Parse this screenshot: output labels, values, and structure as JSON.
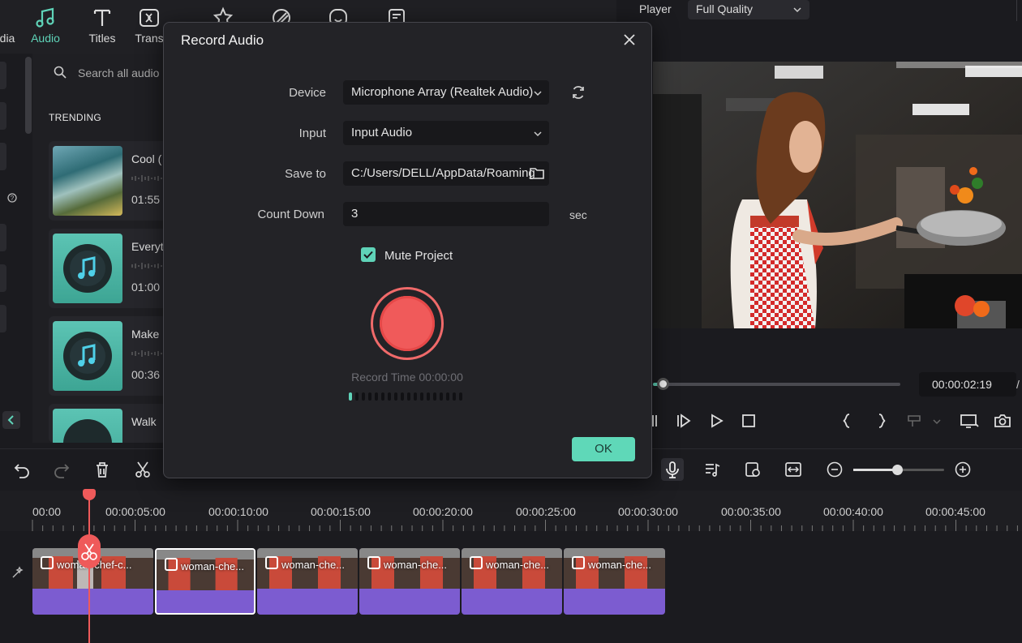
{
  "top_tabs": [
    {
      "label": "dia",
      "icon": "media-icon"
    },
    {
      "label": "Audio",
      "icon": "music-note-icon"
    },
    {
      "label": "Titles",
      "icon": "text-t-icon"
    },
    {
      "label": "Trans",
      "icon": "transition-icon"
    },
    {
      "label": "",
      "icon": "effects-icon"
    },
    {
      "label": "",
      "icon": "filters-icon"
    },
    {
      "label": "",
      "icon": "stickers-icon"
    },
    {
      "label": "",
      "icon": "templates-icon"
    }
  ],
  "audio_panel": {
    "search_placeholder": "Search all audio",
    "section_title": "TRENDING",
    "items": [
      {
        "title": "Cool (",
        "duration": "01:55"
      },
      {
        "title": "Everyt",
        "duration": "01:00"
      },
      {
        "title": "Make",
        "duration": "00:36"
      },
      {
        "title": "Walk",
        "duration": ""
      }
    ]
  },
  "player": {
    "label": "Player",
    "quality": "Full Quality",
    "timecode": "00:00:02:19",
    "timecode_suffix": "/",
    "progress": 0.04
  },
  "record_dialog": {
    "title": "Record Audio",
    "device_label": "Device",
    "device_value": "Microphone Array (Realtek Audio)",
    "input_label": "Input",
    "input_value": "Input Audio",
    "save_label": "Save to",
    "save_value": "C:/Users/DELL/AppData/Roaming",
    "countdown_label": "Count Down",
    "countdown_value": "3",
    "countdown_unit": "sec",
    "mute_label": "Mute Project",
    "mute_checked": true,
    "record_time": "Record Time 00:00:00",
    "ok_label": "OK"
  },
  "ruler": [
    "00:00",
    "00:00:05:00",
    "00:00:10:00",
    "00:00:15:00",
    "00:00:20:00",
    "00:00:25:00",
    "00:00:30:00",
    "00:00:35:00",
    "00:00:40:00",
    "00:00:45:00"
  ],
  "clips": [
    "woman-chef-c...",
    "woman-che...",
    "woman-che...",
    "woman-che...",
    "woman-che...",
    "woman-che..."
  ],
  "colors": {
    "accent": "#5fd3b8",
    "clip": "#7c5cd0",
    "playhead": "#ef5a5a",
    "record": "#f05a5a"
  }
}
